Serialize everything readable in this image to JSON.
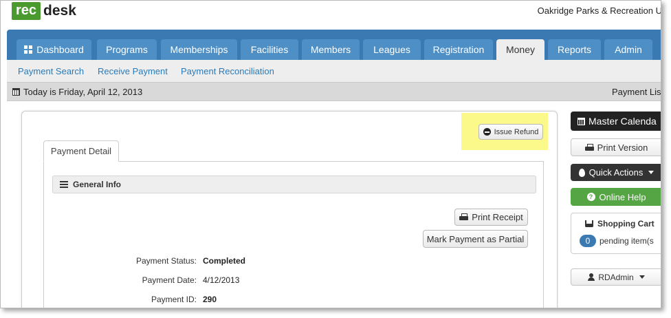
{
  "header": {
    "logo_rec": "rec",
    "logo_desk": "desk",
    "org_name": "Oakridge Parks & Recreation U"
  },
  "nav": {
    "tabs": [
      {
        "label": "Dashboard",
        "icon": "grid-icon",
        "active": false
      },
      {
        "label": "Programs",
        "active": false
      },
      {
        "label": "Memberships",
        "active": false
      },
      {
        "label": "Facilities",
        "active": false
      },
      {
        "label": "Members",
        "active": false
      },
      {
        "label": "Leagues",
        "active": false
      },
      {
        "label": "Registration",
        "active": false
      },
      {
        "label": "Money",
        "active": true
      },
      {
        "label": "Reports",
        "active": false
      },
      {
        "label": "Admin",
        "active": false
      }
    ],
    "active_color": "#eeeeee",
    "bar_color": "#3a79b1"
  },
  "subnav": {
    "links": [
      "Payment Search",
      "Receive Payment",
      "Payment Reconciliation"
    ]
  },
  "datebar": {
    "today": "Today is Friday, April 12, 2013",
    "right_link": "Payment Lis"
  },
  "content": {
    "issue_refund_label": "Issue Refund",
    "highlight_color": "#fbf98a",
    "tab_label": "Payment Detail",
    "section_title": "General Info",
    "print_receipt_label": "Print Receipt",
    "mark_partial_label": "Mark Payment as Partial",
    "fields": [
      {
        "label": "Payment Status:",
        "value": "Completed",
        "bold": true
      },
      {
        "label": "Payment Date:",
        "value": "4/12/2013",
        "bold": false
      },
      {
        "label": "Payment ID:",
        "value": "290",
        "bold": true
      }
    ]
  },
  "sidebar": {
    "master_calendar": "Master Calenda",
    "print_version": "Print Version",
    "quick_actions": "Quick Actions",
    "online_help": "Online Help",
    "cart_title": "Shopping Cart",
    "cart_count": "0",
    "cart_pending": "pending item(s",
    "user": "RDAdmin",
    "help_color": "#55a545"
  }
}
